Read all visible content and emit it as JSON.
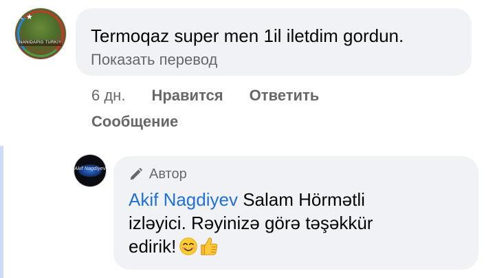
{
  "comment": {
    "avatar_caption": "NANIDAPIG TURKIYE",
    "text": "Termoqaz super men 1il iletdim gordun.",
    "translate_label": "Показать перевод",
    "time": "6 дн.",
    "like_label": "Нравится",
    "reply_label": "Ответить",
    "message_label": "Сообщение"
  },
  "reply": {
    "avatar_caption": "Akif Nagdiyev",
    "author_badge": "Автор",
    "author_name": "Akif Nagdiyev",
    "text": " Salam Hörmətli izləyici. Rəyinizə görə təşəkkür edirik!",
    "emojis": [
      "smiling-face-icon",
      "thumbs-up-icon"
    ]
  },
  "colors": {
    "bubble_bg": "#f0f2f5",
    "secondary_text": "#65676b",
    "link_blue": "#216fdb",
    "thread_line": "#cfdcf8"
  }
}
